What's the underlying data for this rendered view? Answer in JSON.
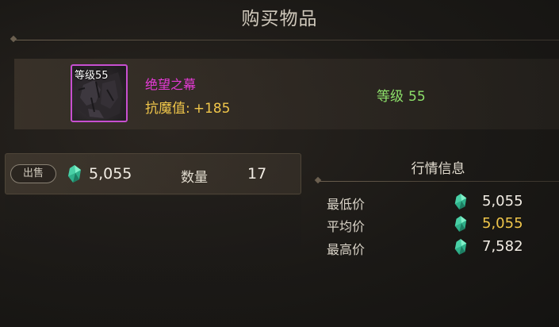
{
  "window": {
    "title": "购买物品"
  },
  "item": {
    "level_tag": "等级55",
    "name": "绝望之幕",
    "stat_label": "抗魔值:",
    "stat_value": "+185",
    "level_label": "等级",
    "level_value": "55",
    "rarity_color": "#c74fd0"
  },
  "sell": {
    "badge": "出售",
    "price": "5,055",
    "quantity_label": "数量",
    "quantity_value": "17"
  },
  "market": {
    "title": "行情信息",
    "rows": [
      {
        "label": "最低价",
        "value": "5,055"
      },
      {
        "label": "平均价",
        "value": "5,055"
      },
      {
        "label": "最高价",
        "value": "7,582"
      }
    ]
  },
  "icons": {
    "currency": "green-gem-icon"
  },
  "colors": {
    "item_name": "#e53ad6",
    "stat": "#f0c64a",
    "level": "#8de06a",
    "average_price": "#f0c64a"
  }
}
